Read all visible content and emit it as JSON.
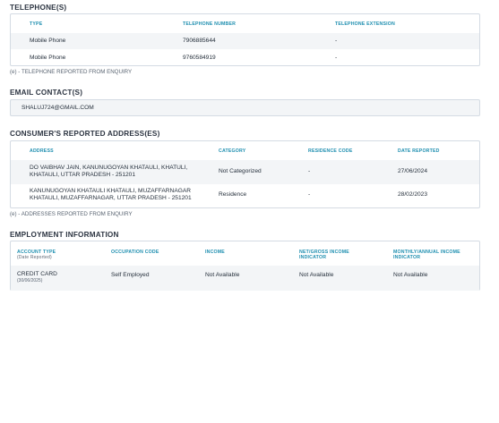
{
  "telephones": {
    "title": "TELEPHONE(S)",
    "headers": {
      "type": "TYPE",
      "number": "TELEPHONE NUMBER",
      "extension": "TELEPHONE EXTENSION"
    },
    "rows": [
      {
        "type": "Mobile Phone",
        "number": "7906885644",
        "extension": "-"
      },
      {
        "type": "Mobile Phone",
        "number": "9760584919",
        "extension": "-"
      }
    ],
    "note": "(e) - TELEPHONE REPORTED FROM ENQUIRY"
  },
  "email": {
    "title": "EMAIL CONTACT(S)",
    "value": "SHALUJ724@GMAIL.COM"
  },
  "addresses": {
    "title": "CONSUMER'S REPORTED ADDRESS(ES)",
    "headers": {
      "address": "ADDRESS",
      "category": "CATEGORY",
      "residence": "RESIDENCE CODE",
      "date": "DATE REPORTED"
    },
    "rows": [
      {
        "address_l1": "DO VAIBHAV JAIN, KANUNUGOYAN KHATAULI, KHATULI,",
        "address_l2": "KHATAULI, UTTAR PRADESH - 251201",
        "category": "Not Categorized",
        "residence": "-",
        "date": "27/06/2024"
      },
      {
        "address_l1": "KANUNUGOYAN KHATAULI KHATAULI, MUZAFFARNAGAR",
        "address_l2": "KHATAULI, MUZAFFARNAGAR, UTTAR PRADESH - 251201",
        "category": "Residence",
        "residence": "-",
        "date": "28/02/2023"
      }
    ],
    "note": "(e) - ADDRESSES REPORTED FROM ENQUIRY"
  },
  "employment": {
    "title": "EMPLOYMENT INFORMATION",
    "headers": {
      "account_type": "ACCOUNT TYPE",
      "account_sub": "(Date Reported)",
      "occupation": "OCCUPATION CODE",
      "income": "INCOME",
      "net_gross_l1": "NET/GROSS INCOME",
      "net_gross_l2": "INDICATOR",
      "monthly_l1": "MONTHLY/ANNUAL INCOME",
      "monthly_l2": "INDICATOR"
    },
    "row": {
      "account_type": "CREDIT CARD",
      "account_date": "(30/06/2025)",
      "occupation": "Self Employed",
      "income": "Not Available",
      "net_gross": "Not Available",
      "monthly": "Not Available"
    }
  }
}
